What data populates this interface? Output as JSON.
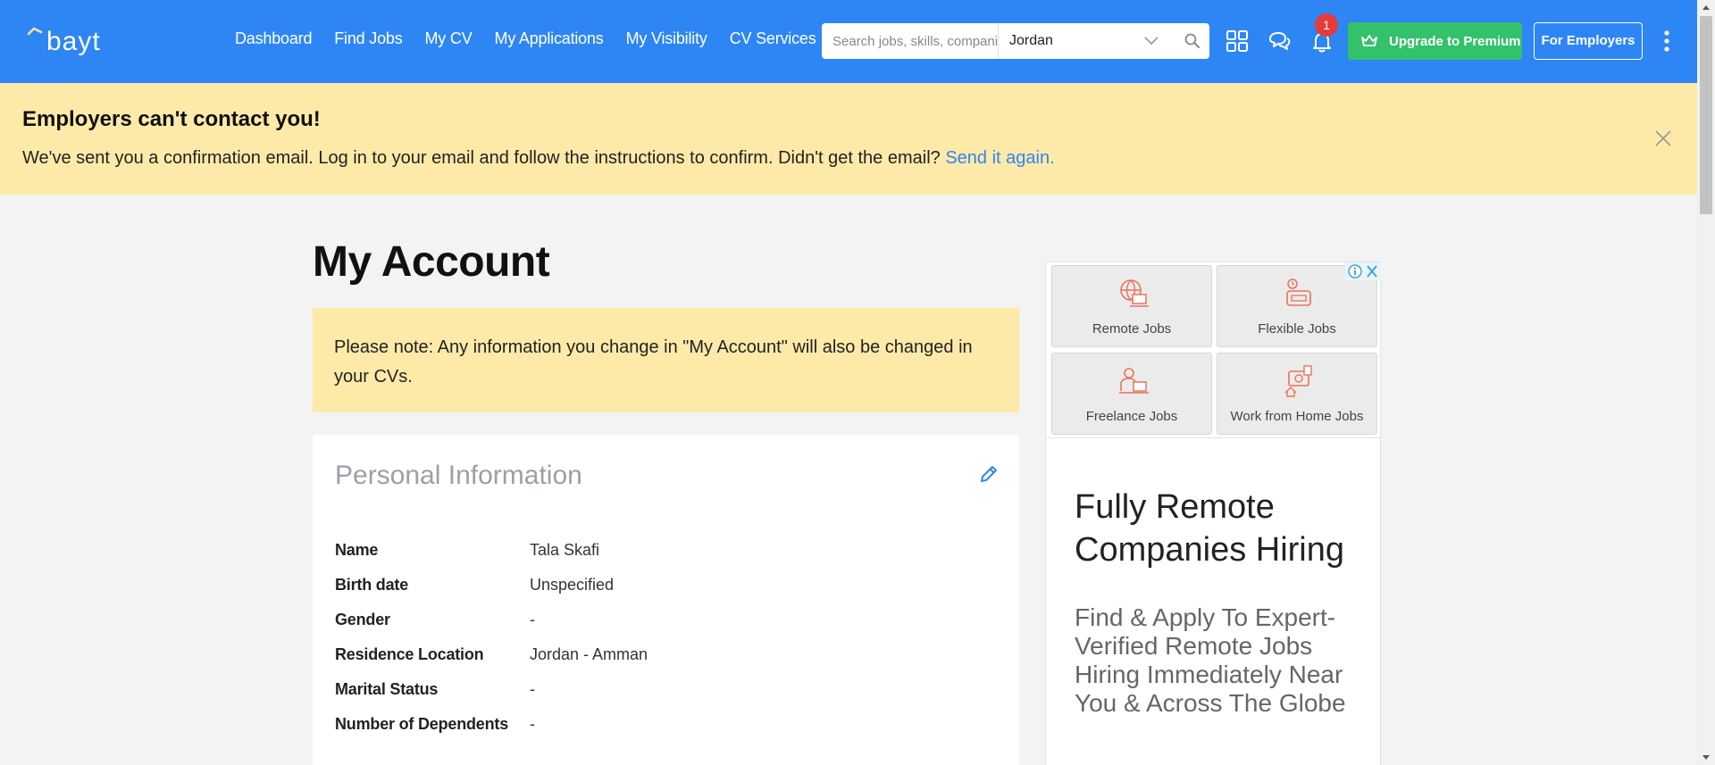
{
  "header": {
    "logo_text": "bayt",
    "nav": [
      "Dashboard",
      "Find Jobs",
      "My CV",
      "My Applications",
      "My Visibility",
      "CV Services"
    ],
    "search_placeholder": "Search jobs, skills, companies",
    "location_value": "Jordan",
    "notification_count": "1",
    "premium_label": "Upgrade to Premium",
    "employers_label": "For Employers",
    "colors": {
      "bar": "#2e86f5",
      "premium": "#33c26b",
      "badge": "#e63b3b"
    }
  },
  "banner": {
    "title": "Employers can't contact you!",
    "message": "We've sent you a confirmation email. Log in to your email and follow the instructions to confirm. Didn't get the email?",
    "link_label": "Send it again."
  },
  "main": {
    "title": "My Account",
    "note": "Please note: Any information you change in \"My Account\" will also be changed in your CVs.",
    "personal": {
      "heading": "Personal Information",
      "rows": [
        {
          "label": "Name",
          "value": "Tala Skafi"
        },
        {
          "label": "Birth date",
          "value": "Unspecified"
        },
        {
          "label": "Gender",
          "value": "-"
        },
        {
          "label": "Residence Location",
          "value": "Jordan - Amman"
        },
        {
          "label": "Marital Status",
          "value": "-"
        },
        {
          "label": "Number of Dependents",
          "value": "-"
        }
      ]
    }
  },
  "ad": {
    "tiles": [
      "Remote Jobs",
      "Flexible Jobs",
      "Freelance Jobs",
      "Work from Home Jobs"
    ],
    "headline": "Fully Remote Companies Hiring",
    "body": "Find & Apply To Expert-Verified Remote Jobs Hiring Immediately Near You & Across The Globe"
  }
}
